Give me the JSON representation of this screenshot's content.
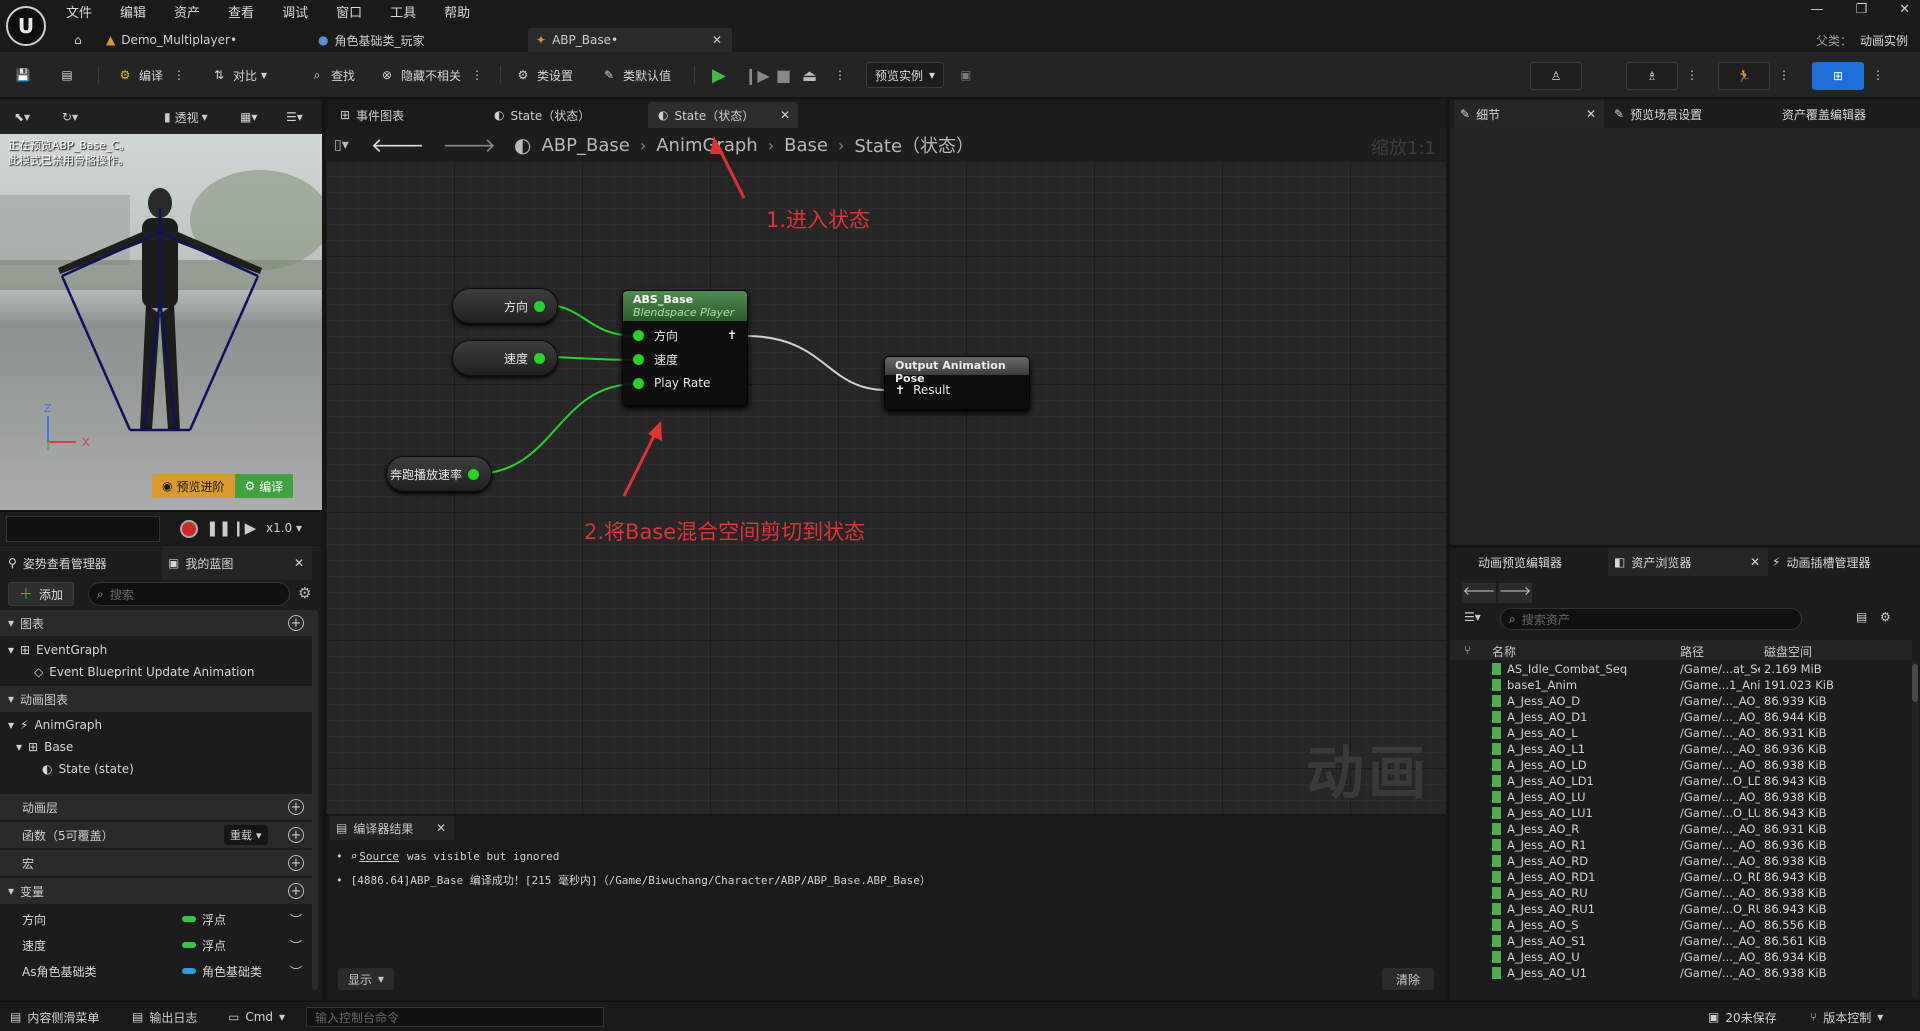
{
  "menu": [
    "文件",
    "编辑",
    "资产",
    "查看",
    "调试",
    "窗口",
    "工具",
    "帮助"
  ],
  "window_tabs": [
    {
      "label": "Demo_Multiplayer•"
    },
    {
      "label": "角色基础类_玩家"
    },
    {
      "label": "ABP_Base•"
    }
  ],
  "parent_class": {
    "label": "父类：",
    "value": "动画实例"
  },
  "toolbar": {
    "compile": "编译",
    "diff": "对比",
    "find": "查找",
    "hide_unrelated": "隐藏不相关",
    "class_settings": "类设置",
    "class_defaults": "类默认值",
    "preview_instance": "预览实例"
  },
  "viewport": {
    "perspective": "透视",
    "warning_line1": "正在预览ABP_Base_C。",
    "warning_line2": "此模式已禁用骨骼操作。",
    "preview_btn": "预览进阶",
    "edit_btn": "编译",
    "speed": "x1.0",
    "axis_z": "Z",
    "axis_x": "X"
  },
  "left_panel": {
    "tabs": [
      "姿势查看管理器",
      "我的蓝图"
    ],
    "add_btn": "添加",
    "search_placeholder": "搜索",
    "sections": {
      "graphs": "图表",
      "anim_graphs": "动画图表",
      "anim_layers": "动画层",
      "functions": "函数（5可覆盖）",
      "override_btn": "重载",
      "macros": "宏",
      "variables": "变量"
    },
    "tree": {
      "event_graph": "EventGraph",
      "event_update": "Event Blueprint Update Animation",
      "anim_graph": "AnimGraph",
      "base": "Base",
      "state": "State (state)"
    },
    "variables": [
      {
        "name": "方向",
        "type": "浮点",
        "color": "#2ecc40"
      },
      {
        "name": "速度",
        "type": "浮点",
        "color": "#2ecc40"
      },
      {
        "name": "As角色基础类",
        "type": "角色基础类",
        "color": "#2d9be0"
      }
    ]
  },
  "graph_tabs": [
    "事件图表",
    "State（状态）",
    "State（状态）"
  ],
  "breadcrumb": [
    "ABP_Base",
    "AnimGraph",
    "Base",
    "State（状态）"
  ],
  "zoom": "缩放1:1",
  "watermark": "动画",
  "annotations": {
    "a1": "1.进入状态",
    "a2": "2.将Base混合空间剪切到状态"
  },
  "nodes": {
    "var_direction": "方向",
    "var_speed": "速度",
    "var_runrate": "奔跑播放速率",
    "blendspace_title": "ABS_Base",
    "blendspace_sub": "Blendspace Player",
    "bs_pins": [
      "方向",
      "速度",
      "Play Rate"
    ],
    "output_title": "Output Animation Pose",
    "output_pin": "Result"
  },
  "compiler": {
    "tab": "编译器结果",
    "line1_link": "Source",
    "line1_rest": "was visible but ignored",
    "line2": "[4886.64]ABP_Base 编译成功！[215 毫秒内]（/Game/Biwuchang/Character/ABP/ABP_Base.ABP_Base）",
    "show_btn": "显示",
    "clear_btn": "清除"
  },
  "right_panel": {
    "tabs_top": [
      "细节",
      "预览场景设置",
      "资产覆盖编辑器"
    ],
    "tabs_bottom": [
      "动画预览编辑器",
      "资产浏览器",
      "动画插槽管理器"
    ],
    "search_placeholder": "搜索资产",
    "columns": [
      "名称",
      "路径",
      "磁盘空间"
    ],
    "assets": [
      {
        "name": "AS_Idle_Combat_Seq",
        "path": "/Game/...at_Seq",
        "size": "2.169 MiB"
      },
      {
        "name": "base1_Anim",
        "path": "/Game...1_Anim",
        "size": "191.023 KiB"
      },
      {
        "name": "A_Jess_AO_D",
        "path": "/Game/..._AO_D",
        "size": "86.939 KiB"
      },
      {
        "name": "A_Jess_AO_D1",
        "path": "/Game/..._AO_D1",
        "size": "86.944 KiB"
      },
      {
        "name": "A_Jess_AO_L",
        "path": "/Game/..._AO_L",
        "size": "86.931 KiB"
      },
      {
        "name": "A_Jess_AO_L1",
        "path": "/Game/..._AO_L1",
        "size": "86.936 KiB"
      },
      {
        "name": "A_Jess_AO_LD",
        "path": "/Game/..._AO_LD",
        "size": "86.938 KiB"
      },
      {
        "name": "A_Jess_AO_LD1",
        "path": "/Game/...O_LD1",
        "size": "86.943 KiB"
      },
      {
        "name": "A_Jess_AO_LU",
        "path": "/Game/..._AO_LU",
        "size": "86.938 KiB"
      },
      {
        "name": "A_Jess_AO_LU1",
        "path": "/Game/...O_LU1",
        "size": "86.943 KiB"
      },
      {
        "name": "A_Jess_AO_R",
        "path": "/Game/..._AO_R",
        "size": "86.931 KiB"
      },
      {
        "name": "A_Jess_AO_R1",
        "path": "/Game/..._AO_R1",
        "size": "86.936 KiB"
      },
      {
        "name": "A_Jess_AO_RD",
        "path": "/Game/..._AO_RD",
        "size": "86.938 KiB"
      },
      {
        "name": "A_Jess_AO_RD1",
        "path": "/Game/...O_RD1",
        "size": "86.943 KiB"
      },
      {
        "name": "A_Jess_AO_RU",
        "path": "/Game/..._AO_RU",
        "size": "86.938 KiB"
      },
      {
        "name": "A_Jess_AO_RU1",
        "path": "/Game/...O_RU1",
        "size": "86.943 KiB"
      },
      {
        "name": "A_Jess_AO_S",
        "path": "/Game/..._AO_S",
        "size": "86.556 KiB"
      },
      {
        "name": "A_Jess_AO_S1",
        "path": "/Game/..._AO_S1",
        "size": "86.561 KiB"
      },
      {
        "name": "A_Jess_AO_U",
        "path": "/Game/..._AO_U",
        "size": "86.934 KiB"
      },
      {
        "name": "A_Jess_AO_U1",
        "path": "/Game/..._AO_U1",
        "size": "86.938 KiB"
      }
    ]
  },
  "statusbar": {
    "content_drawer": "内容侧滑菜单",
    "output_log": "输出日志",
    "cmd": "Cmd",
    "console_placeholder": "输入控制台命令",
    "unsaved": "20未保存",
    "source_control": "版本控制"
  },
  "colors": {
    "accent_blue": "#1e6fd9",
    "pin_green": "#23d623",
    "annotation_red": "#e03434",
    "node_header_green": "#3e7d3e",
    "play_green": "#3fbf3f"
  }
}
